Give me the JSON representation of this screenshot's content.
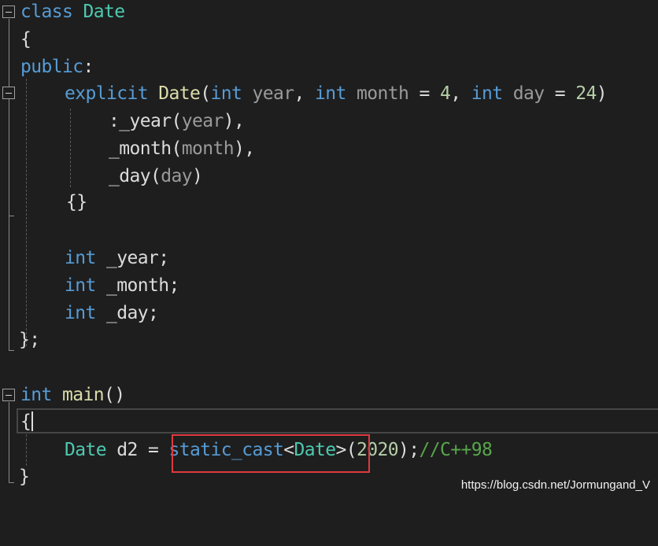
{
  "colors": {
    "background": "#1e1e1e",
    "keyword": "#569cd6",
    "type": "#4ec9b0",
    "function": "#dcdcaa",
    "parameter": "#9a9a9a",
    "number": "#b5cea8",
    "comment": "#57a64a",
    "plain": "#dcdcdc",
    "highlight_border": "#e0393e"
  },
  "code": {
    "l1": {
      "kw_class": "class",
      "type_date": "Date"
    },
    "l2": {
      "brace": "{"
    },
    "l3": {
      "kw_public": "public",
      "colon": ":"
    },
    "l4": {
      "kw_explicit": "explicit",
      "fn_date": "Date",
      "open_paren": "(",
      "kw_int1": "int",
      "param_year": "year",
      "comma1": ",",
      "kw_int2": "int",
      "param_month": "month",
      "eq1": "=",
      "num4": "4",
      "comma2": ",",
      "kw_int3": "int",
      "param_day": "day",
      "eq2": "=",
      "num24": "24",
      "close_paren": ")"
    },
    "l5": {
      "member": ":_year",
      "open": "(",
      "arg": "year",
      "close": "),"
    },
    "l6": {
      "member": "_month",
      "open": "(",
      "arg": "month",
      "close": "),"
    },
    "l7": {
      "member": "_day",
      "open": "(",
      "arg": "day",
      "close": ")"
    },
    "l8": {
      "braces": "{}"
    },
    "l10": {
      "kw_int": "int",
      "member": "_year;"
    },
    "l11": {
      "kw_int": "int",
      "member": "_month;"
    },
    "l12": {
      "kw_int": "int",
      "member": "_day;"
    },
    "l13": {
      "close": "};"
    },
    "l15": {
      "kw_int": "int",
      "fn_main": "main",
      "parens": "()"
    },
    "l16": {
      "brace": "{"
    },
    "l17": {
      "type_date": "Date",
      "var": "d2",
      "eq": "=",
      "kw_static_cast": "static_cast",
      "lt": "<",
      "type_date2": "Date",
      "gt": ">",
      "open": "(",
      "num2020": "2020",
      "close": ");",
      "comment": "//C++98"
    },
    "l18": {
      "brace": "}"
    }
  },
  "watermark": "https://blog.csdn.net/Jormungand_V"
}
